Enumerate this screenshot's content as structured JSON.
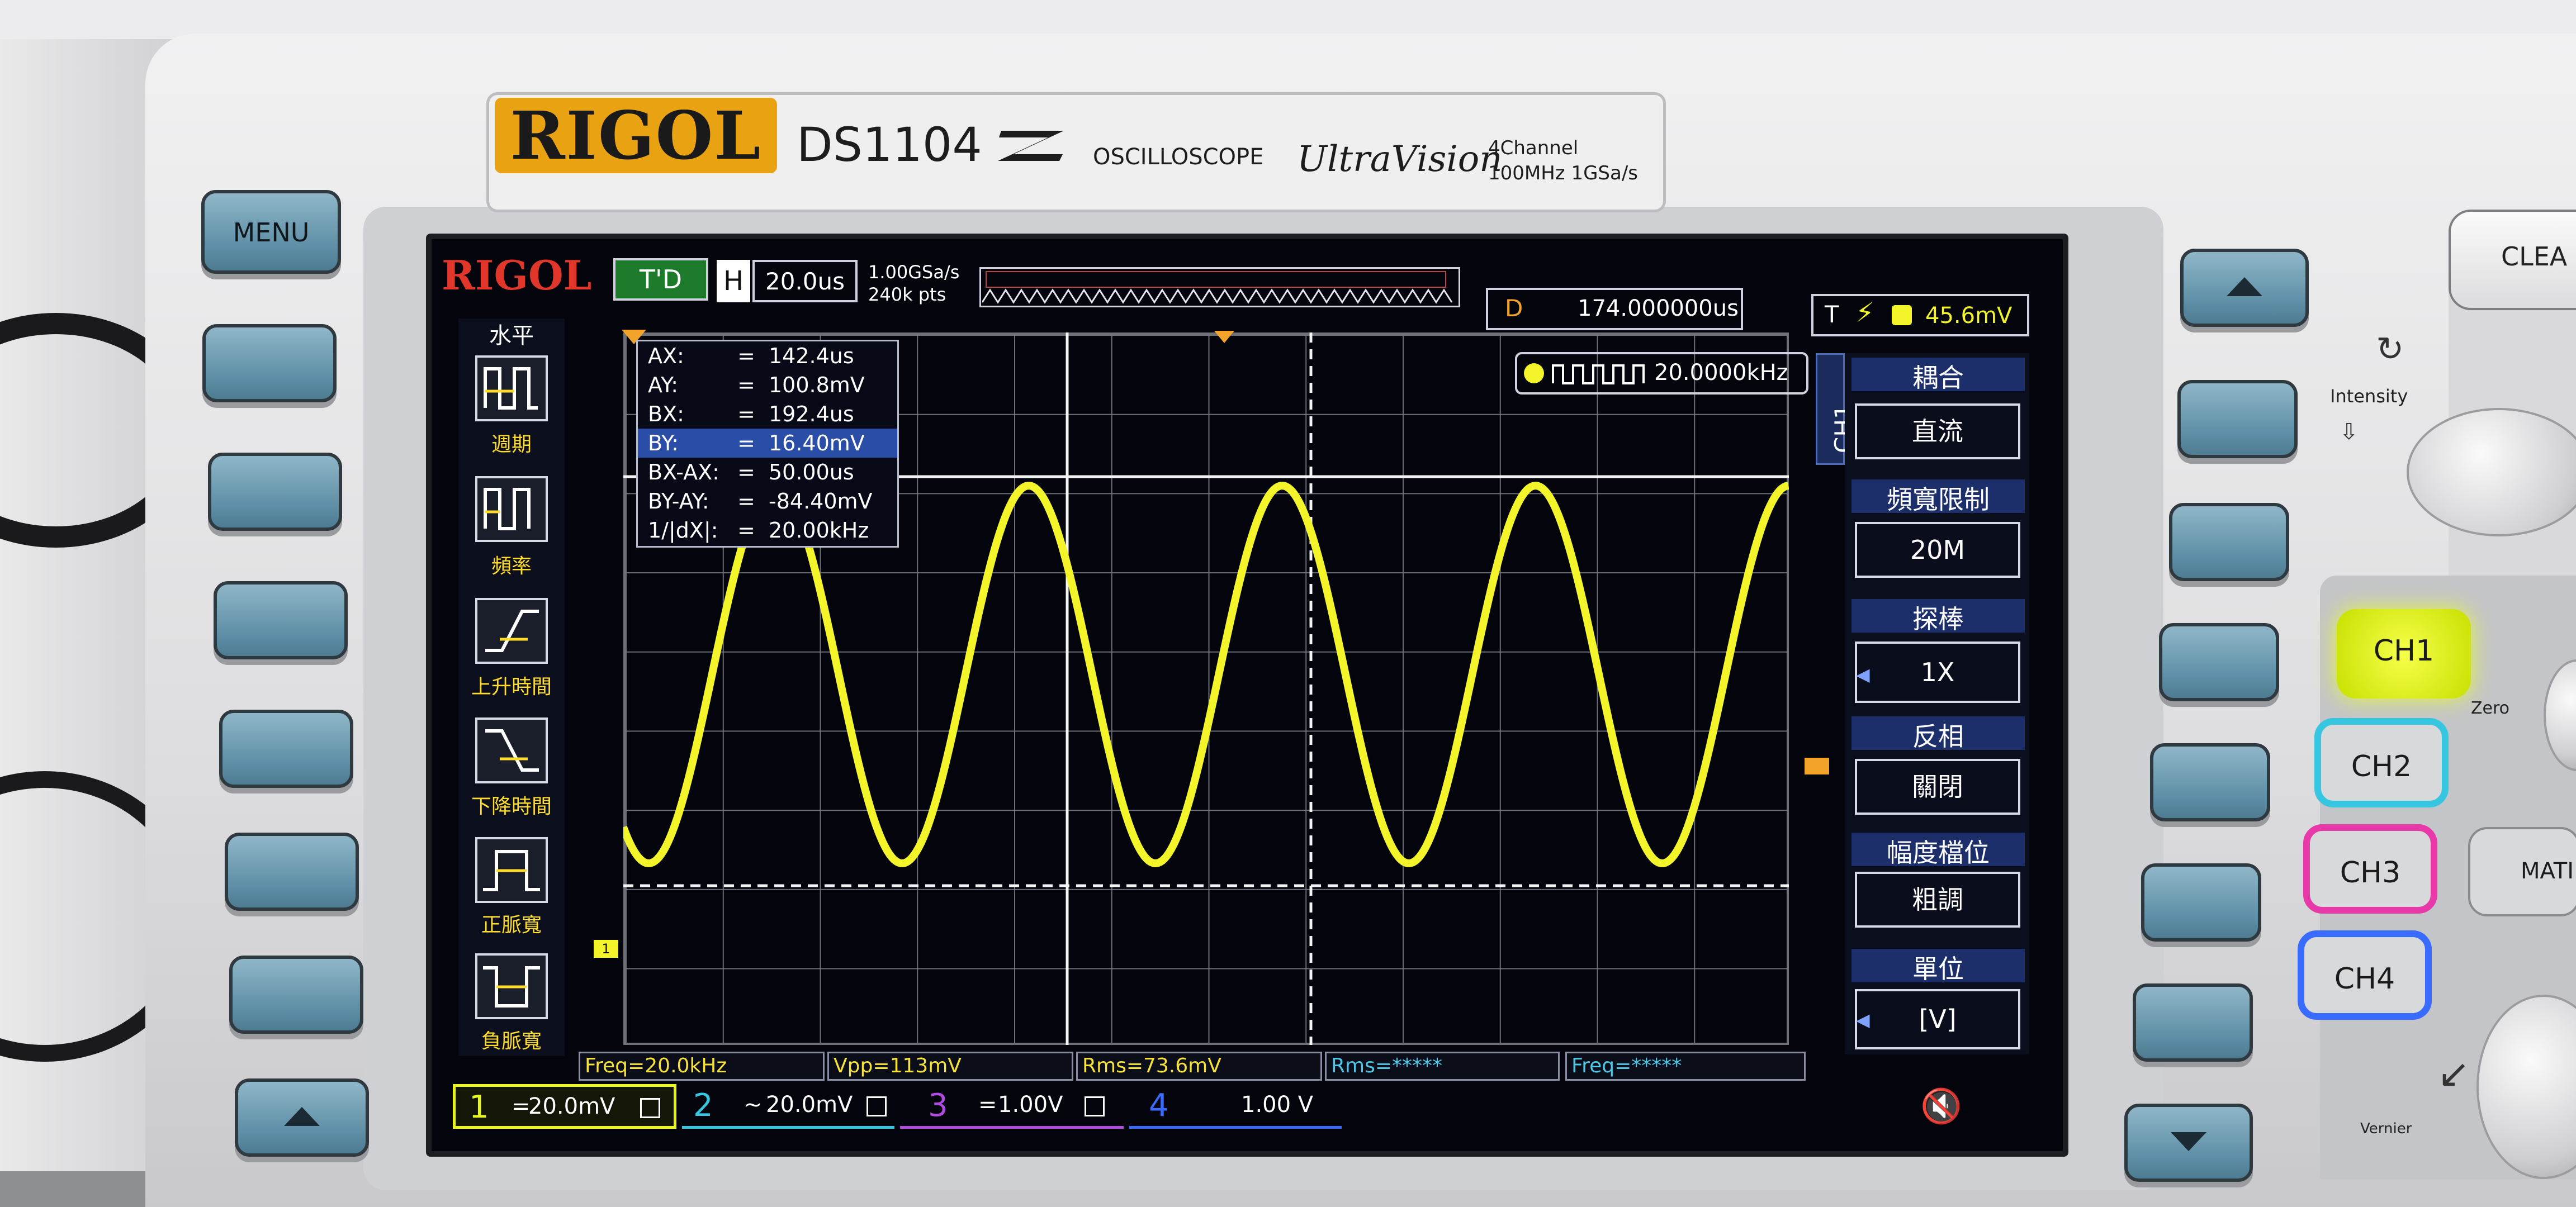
{
  "device": {
    "brand": "RIGOL",
    "model": "DS1104",
    "type_label": "OSCILLOSCOPE",
    "series": "UltraVision",
    "spec_line1": "4Channel",
    "spec_line2": "100MHz  1GSa/s"
  },
  "front_panel": {
    "menu_button": "MENU",
    "clear_button": "CLEA",
    "intensity_label": "Intensity",
    "zero_label": "Zero",
    "vernier_label": "Vernier",
    "math_button": "MATI",
    "channel_buttons": [
      "CH1",
      "CH2",
      "CH3",
      "CH4"
    ],
    "channel_colors": [
      "#e6f51a",
      "#36c6e0",
      "#e73aa8",
      "#3a6bff"
    ]
  },
  "screen": {
    "logo": "RIGOL",
    "trigger_status": "T'D",
    "timebase_label": "H",
    "timebase_value": "20.0us",
    "sample_rate": "1.00GSa/s",
    "memory_depth": "240k pts",
    "delay_label": "D",
    "delay_value": "174.000000us",
    "trigger_label": "T",
    "trigger_level": "45.6mV",
    "frequency_counter": "20.0000kHz",
    "left_menu": {
      "title": "水平",
      "items": [
        "週期",
        "頻率",
        "上升時間",
        "下降時間",
        "正脈寬",
        "負脈寬"
      ]
    },
    "right_menu": {
      "channel_tab": "CH1",
      "items": [
        {
          "title": "耦合",
          "value": "直流"
        },
        {
          "title": "頻寬限制",
          "value": "20M"
        },
        {
          "title": "探棒",
          "value": "1X"
        },
        {
          "title": "反相",
          "value": "關閉"
        },
        {
          "title": "幅度檔位",
          "value": "粗調"
        },
        {
          "title": "單位",
          "value": "[V]"
        }
      ]
    },
    "cursors": [
      {
        "label": "AX:",
        "value": "142.4us"
      },
      {
        "label": "AY:",
        "value": "100.8mV"
      },
      {
        "label": "BX:",
        "value": "192.4us"
      },
      {
        "label": "BY:",
        "value": "16.40mV"
      },
      {
        "label": "BX-AX:",
        "value": "50.00us"
      },
      {
        "label": "BY-AY:",
        "value": "-84.40mV"
      },
      {
        "label": "1/|dX|:",
        "value": "20.00kHz"
      }
    ],
    "cursor_selected_index": 3,
    "measurements": [
      "Freq=20.0kHz",
      "Vpp=113mV",
      "Rms=73.6mV",
      "Rms=*****",
      "Freq=*****"
    ],
    "channels_bar": [
      {
        "num": "1",
        "coupling": "=",
        "scale": "20.0mV",
        "color": "#e6f51a"
      },
      {
        "num": "2",
        "coupling": "~",
        "scale": "20.0mV",
        "color": "#36c6e0"
      },
      {
        "num": "3",
        "coupling": "=",
        "scale": "1.00V",
        "color": "#b04be0"
      },
      {
        "num": "4",
        "coupling": "",
        "scale": "1.00 V",
        "color": "#3a6bff"
      }
    ],
    "trace": {
      "channel": "CH1",
      "waveform": "sine",
      "frequency": "20.0kHz",
      "color": "#f3f52a",
      "cycles_visible": 4.6
    }
  }
}
